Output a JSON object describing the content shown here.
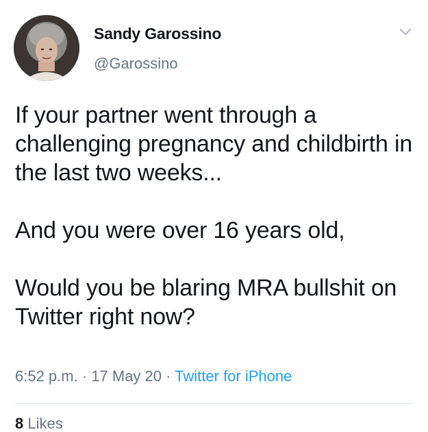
{
  "author": {
    "display_name": "Sandy Garossino",
    "handle": "@Garossino"
  },
  "icons": {
    "menu": "chevron-down-icon",
    "avatar": "profile-photo"
  },
  "tweet": {
    "paragraphs": [
      "If your partner went through a challenging pregnancy and childbirth in the last two weeks...",
      "And you were over 16 years old,",
      "Would you be blaring MRA bullshit on Twitter right now?"
    ]
  },
  "meta": {
    "time": "6:52 p.m.",
    "separator": " · ",
    "date": "17 May 20",
    "source": "Twitter for iPhone"
  },
  "stats": {
    "likes_count": "8",
    "likes_label": "Likes"
  },
  "colors": {
    "text": "#14171a",
    "secondary": "#657786",
    "link": "#1da1f2",
    "divider": "#e1e8ed"
  }
}
